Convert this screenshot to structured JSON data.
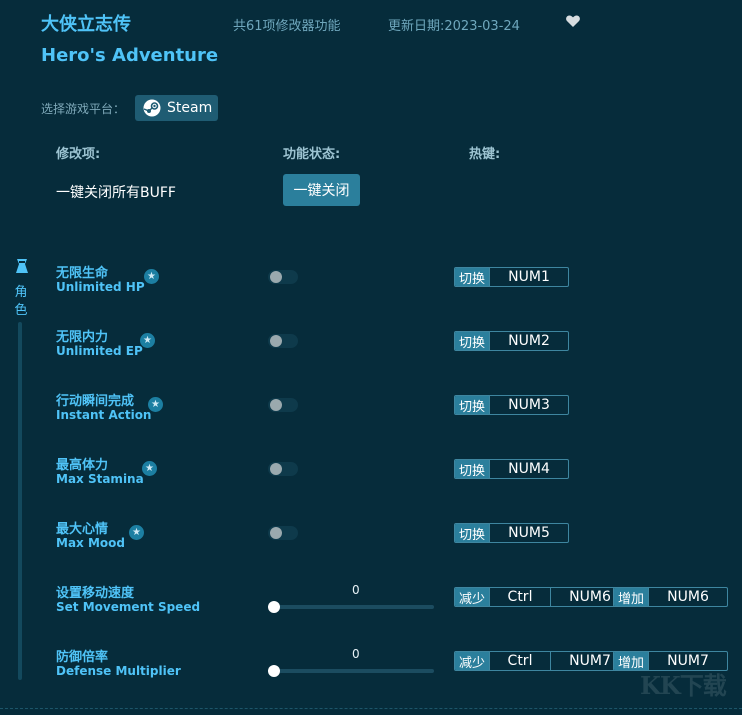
{
  "header": {
    "title_cn": "大侠立志传",
    "title_en": "Hero's Adventure",
    "feature_count": "共61项修改器功能",
    "update_date": "更新日期:2023-03-24"
  },
  "platform": {
    "label": "选择游戏平台：",
    "button": "Steam"
  },
  "columns": {
    "item": "修改项:",
    "status": "功能状态:",
    "hotkey": "热键:"
  },
  "global": {
    "label": "一键关闭所有BUFF",
    "button": "一键关闭"
  },
  "sidebar": {
    "category": "角色"
  },
  "toggle_rows": [
    {
      "cn": "无限生命",
      "en": "Unlimited HP",
      "tag": "切换",
      "key": "NUM1",
      "on": false
    },
    {
      "cn": "无限内力",
      "en": "Unlimited EP",
      "tag": "切换",
      "key": "NUM2",
      "on": false
    },
    {
      "cn": "行动瞬间完成",
      "en": "Instant Action",
      "tag": "切换",
      "key": "NUM3",
      "on": false
    },
    {
      "cn": "最高体力",
      "en": "Max Stamina",
      "tag": "切换",
      "key": "NUM4",
      "on": false
    },
    {
      "cn": "最大心情",
      "en": "Max Mood",
      "tag": "切换",
      "key": "NUM5",
      "on": false
    }
  ],
  "slider_rows": [
    {
      "cn": "设置移动速度",
      "en": "Set Movement Speed",
      "value": "0",
      "dec_tag": "减少",
      "dec_mod": "Ctrl",
      "dec_key": "NUM6",
      "inc_tag": "增加",
      "inc_key": "NUM6"
    },
    {
      "cn": "防御倍率",
      "en": "Defense Multiplier",
      "value": "0",
      "dec_tag": "减少",
      "dec_mod": "Ctrl",
      "dec_key": "NUM7",
      "inc_tag": "增加",
      "inc_key": "NUM7"
    }
  ],
  "icons": {
    "favorite": "heart-icon",
    "star": "star-icon",
    "steam": "steam-icon",
    "category": "character-icon"
  },
  "colors": {
    "background": "#062c3b",
    "accent": "#4fc3f7",
    "button": "#2b7f9c"
  },
  "watermark": "KK下载"
}
